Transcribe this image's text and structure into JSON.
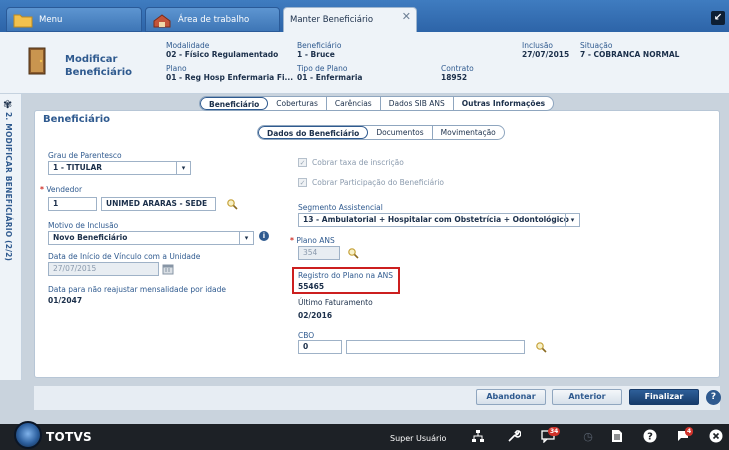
{
  "tabs": {
    "menu": "Menu",
    "area": "Área de trabalho",
    "manter": "Manter Beneficiário"
  },
  "header": {
    "title_line1": "Modificar",
    "title_line2": "Beneficiário",
    "modalidade_label": "Modalidade",
    "modalidade_value": "02 - Físico Regulamentado",
    "beneficiario_label": "Beneficiário",
    "beneficiario_value": "1 - Bruce",
    "inclusao_label": "Inclusão",
    "inclusao_value": "27/07/2015",
    "situacao_label": "Situação",
    "situacao_value": "7 - COBRANCA NORMAL",
    "plano_label": "Plano",
    "plano_value": "01 - Reg Hosp Enfermaria Fi...",
    "tipo_plano_label": "Tipo de Plano",
    "tipo_plano_value": "01 - Enfermaria",
    "contrato_label": "Contrato",
    "contrato_value": "18952"
  },
  "side": {
    "label": "2. MODIFICAR BENEFICIÁRIO (2/2)"
  },
  "main_tabs": [
    "Beneficiário",
    "Coberturas",
    "Carências",
    "Dados SIB ANS",
    "Outras Informações"
  ],
  "section_title": "Beneficiário",
  "sub_tabs": [
    "Dados do Beneficiário",
    "Documentos",
    "Movimentação"
  ],
  "form": {
    "grau_label": "Grau de Parentesco",
    "grau_value": "1 - TITULAR",
    "vendedor_label": "Vendedor",
    "vendedor_code": "1",
    "vendedor_name": "UNIMED ARARAS - SEDE",
    "motivo_label": "Motivo de Inclusão",
    "motivo_value": "Novo Beneficiário",
    "data_inicio_label": "Data de Início de Vínculo com a Unidade",
    "data_inicio_value": "27/07/2015",
    "data_reajuste_label": "Data para não reajustar mensalidade por idade",
    "data_reajuste_value": "01/2047",
    "cobrar_taxa_label": "Cobrar taxa de inscrição",
    "cobrar_participacao_label": "Cobrar Participação do Beneficiário",
    "segmento_label": "Segmento Assistencial",
    "segmento_value": "13 - Ambulatorial + Hospitalar com Obstetrícia + Odontológico",
    "plano_ans_label": "Plano ANS",
    "plano_ans_value": "354",
    "registro_label": "Registro do Plano na ANS",
    "registro_value": "55465",
    "ultimo_fat_label": "Último Faturamento",
    "ultimo_fat_value": "02/2016",
    "cbo_label": "CBO",
    "cbo_code": "0",
    "cbo_desc": ""
  },
  "footer": {
    "abandonar": "Abandonar",
    "anterior": "Anterior",
    "finalizar": "Finalizar"
  },
  "bottombar": {
    "brand": "TOTVS",
    "user": "Super Usuário",
    "messages_badge": "34",
    "notifications_badge": "4"
  },
  "colors": {
    "accent": "#2f5a8f",
    "highlight": "#cc1f1f"
  }
}
